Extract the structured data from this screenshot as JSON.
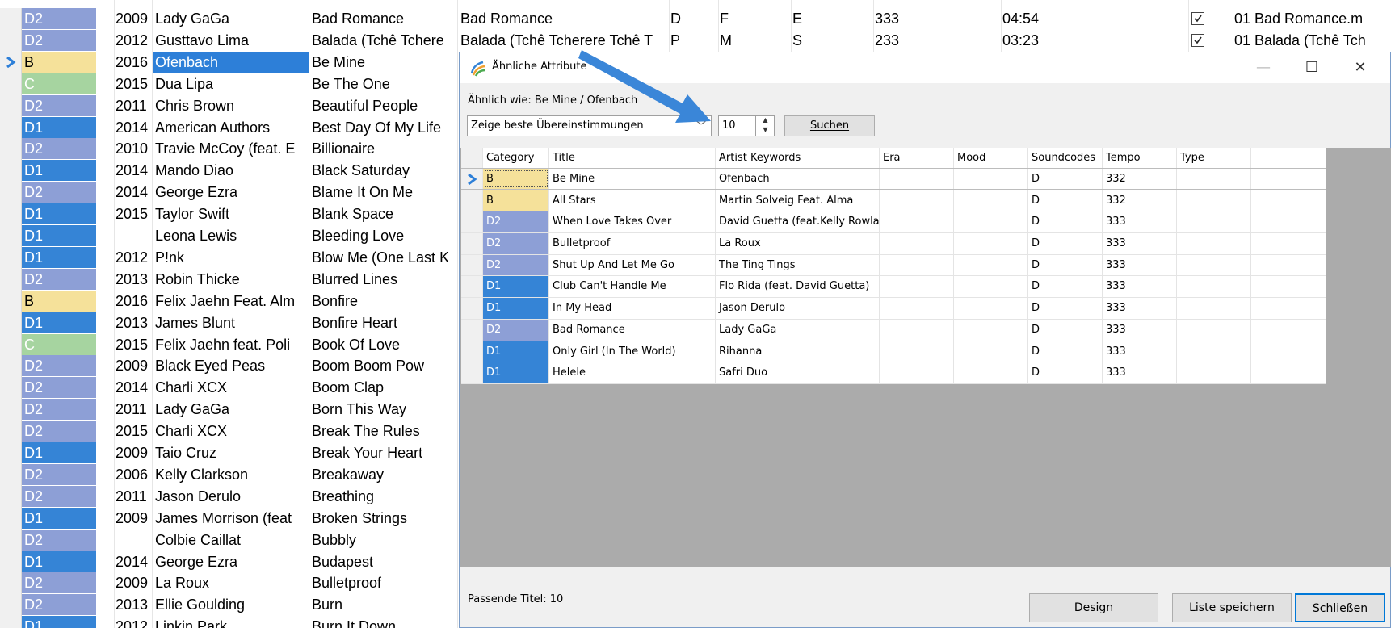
{
  "background_rows": [
    {
      "cat": "D2",
      "catColor": "#8d9fd6",
      "year": "2009",
      "artist": "Lady GaGa",
      "title": "Bad Romance",
      "title2": "Bad Romance",
      "d": "D",
      "f": "F",
      "e": "E",
      "num": "333",
      "time": "04:54",
      "checked": true,
      "file": "01 Bad Romance.m"
    },
    {
      "cat": "D2",
      "catColor": "#8d9fd6",
      "year": "2012",
      "artist": "Gusttavo Lima",
      "title": "Balada (Tchê Tchere",
      "title2": "Balada (Tchê Tcherere Tchê T",
      "d": "P",
      "f": "M",
      "e": "S",
      "num": "233",
      "time": "03:23",
      "checked": true,
      "file": "01 Balada (Tchê Tch"
    },
    {
      "cat": "B",
      "catColor": "#f5e19a",
      "year": "2016",
      "artist": "Ofenbach",
      "title": "Be Mine",
      "selected": true
    },
    {
      "cat": "C",
      "catColor": "#a6d4a0",
      "year": "2015",
      "artist": "Dua Lipa",
      "title": "Be The One"
    },
    {
      "cat": "D2",
      "catColor": "#8d9fd6",
      "year": "2011",
      "artist": "Chris Brown",
      "title": "Beautiful People"
    },
    {
      "cat": "D1",
      "catColor": "#3584d6",
      "year": "2014",
      "artist": "American Authors",
      "title": "Best Day Of My Life"
    },
    {
      "cat": "D2",
      "catColor": "#8d9fd6",
      "year": "2010",
      "artist": "Travie McCoy (feat. E",
      "title": "Billionaire"
    },
    {
      "cat": "D1",
      "catColor": "#3584d6",
      "year": "2014",
      "artist": "Mando Diao",
      "title": "Black Saturday"
    },
    {
      "cat": "D2",
      "catColor": "#8d9fd6",
      "year": "2014",
      "artist": "George Ezra",
      "title": "Blame It On Me"
    },
    {
      "cat": "D1",
      "catColor": "#3584d6",
      "year": "2015",
      "artist": "Taylor Swift",
      "title": "Blank Space"
    },
    {
      "cat": "D1",
      "catColor": "#3584d6",
      "year": "",
      "artist": "Leona Lewis",
      "title": "Bleeding Love"
    },
    {
      "cat": "D1",
      "catColor": "#3584d6",
      "year": "2012",
      "artist": "P!nk",
      "title": "Blow Me (One Last K"
    },
    {
      "cat": "D2",
      "catColor": "#8d9fd6",
      "year": "2013",
      "artist": "Robin Thicke",
      "title": "Blurred Lines"
    },
    {
      "cat": "B",
      "catColor": "#f5e19a",
      "year": "2016",
      "artist": "Felix Jaehn Feat. Alm",
      "title": "Bonfire"
    },
    {
      "cat": "D1",
      "catColor": "#3584d6",
      "year": "2013",
      "artist": "James Blunt",
      "title": "Bonfire Heart"
    },
    {
      "cat": "C",
      "catColor": "#a6d4a0",
      "year": "2015",
      "artist": "Felix Jaehn feat. Poli",
      "title": "Book Of Love"
    },
    {
      "cat": "D2",
      "catColor": "#8d9fd6",
      "year": "2009",
      "artist": "Black Eyed Peas",
      "title": "Boom Boom Pow"
    },
    {
      "cat": "D2",
      "catColor": "#8d9fd6",
      "year": "2014",
      "artist": "Charli XCX",
      "title": "Boom Clap"
    },
    {
      "cat": "D2",
      "catColor": "#8d9fd6",
      "year": "2011",
      "artist": "Lady GaGa",
      "title": "Born This Way"
    },
    {
      "cat": "D2",
      "catColor": "#8d9fd6",
      "year": "2015",
      "artist": "Charli XCX",
      "title": "Break The Rules"
    },
    {
      "cat": "D1",
      "catColor": "#3584d6",
      "year": "2009",
      "artist": "Taio Cruz",
      "title": "Break Your Heart"
    },
    {
      "cat": "D2",
      "catColor": "#8d9fd6",
      "year": "2006",
      "artist": "Kelly Clarkson",
      "title": "Breakaway"
    },
    {
      "cat": "D2",
      "catColor": "#8d9fd6",
      "year": "2011",
      "artist": "Jason Derulo",
      "title": "Breathing"
    },
    {
      "cat": "D1",
      "catColor": "#3584d6",
      "year": "2009",
      "artist": "James Morrison (feat",
      "title": "Broken Strings"
    },
    {
      "cat": "D2",
      "catColor": "#8d9fd6",
      "year": "",
      "artist": "Colbie Caillat",
      "title": "Bubbly"
    },
    {
      "cat": "D1",
      "catColor": "#3584d6",
      "year": "2014",
      "artist": "George Ezra",
      "title": "Budapest"
    },
    {
      "cat": "D2",
      "catColor": "#8d9fd6",
      "year": "2009",
      "artist": "La Roux",
      "title": "Bulletproof"
    },
    {
      "cat": "D2",
      "catColor": "#8d9fd6",
      "year": "2013",
      "artist": "Ellie Goulding",
      "title": "Burn"
    },
    {
      "cat": "D1",
      "catColor": "#3584d6",
      "year": "2012",
      "artist": "Linkin Park",
      "title": "Burn It Down"
    }
  ],
  "dialog": {
    "title": "Ähnliche Attribute",
    "similar_label": "Ähnlich wie: Be Mine / Ofenbach",
    "mode_value": "Zeige beste Übereinstimmungen",
    "count_value": "10",
    "search_label": "Suchen",
    "columns": [
      "Category",
      "Title",
      "Artist Keywords",
      "Era",
      "Mood",
      "Soundcodes",
      "Tempo",
      "Type"
    ],
    "rows": [
      {
        "cat": "B",
        "catColor": "#f5e19a",
        "title": "Be Mine",
        "artist": "Ofenbach",
        "era": "",
        "mood": "",
        "sound": "D",
        "tempo": "332",
        "type": ""
      },
      {
        "cat": "B",
        "catColor": "#f5e19a",
        "title": "All Stars",
        "artist": "Martin Solveig Feat. Alma",
        "era": "",
        "mood": "",
        "sound": "D",
        "tempo": "332",
        "type": ""
      },
      {
        "cat": "D2",
        "catColor": "#8d9fd6",
        "title": "When Love Takes Over",
        "artist": "David Guetta (feat.Kelly Rowlar",
        "era": "",
        "mood": "",
        "sound": "D",
        "tempo": "333",
        "type": ""
      },
      {
        "cat": "D2",
        "catColor": "#8d9fd6",
        "title": "Bulletproof",
        "artist": "La Roux",
        "era": "",
        "mood": "",
        "sound": "D",
        "tempo": "333",
        "type": ""
      },
      {
        "cat": "D2",
        "catColor": "#8d9fd6",
        "title": "Shut Up And Let Me Go",
        "artist": "The Ting Tings",
        "era": "",
        "mood": "",
        "sound": "D",
        "tempo": "333",
        "type": ""
      },
      {
        "cat": "D1",
        "catColor": "#3584d6",
        "title": "Club Can't Handle Me",
        "artist": "Flo Rida (feat. David Guetta)",
        "era": "",
        "mood": "",
        "sound": "D",
        "tempo": "333",
        "type": ""
      },
      {
        "cat": "D1",
        "catColor": "#3584d6",
        "title": "In My Head",
        "artist": "Jason Derulo",
        "era": "",
        "mood": "",
        "sound": "D",
        "tempo": "333",
        "type": ""
      },
      {
        "cat": "D2",
        "catColor": "#8d9fd6",
        "title": "Bad Romance",
        "artist": "Lady GaGa",
        "era": "",
        "mood": "",
        "sound": "D",
        "tempo": "333",
        "type": ""
      },
      {
        "cat": "D1",
        "catColor": "#3584d6",
        "title": "Only Girl (In The World)",
        "artist": "Rihanna",
        "era": "",
        "mood": "",
        "sound": "D",
        "tempo": "333",
        "type": ""
      },
      {
        "cat": "D1",
        "catColor": "#3584d6",
        "title": "Helele",
        "artist": "Safri Duo",
        "era": "",
        "mood": "",
        "sound": "D",
        "tempo": "333",
        "type": ""
      }
    ],
    "status": "Passende Titel: 10",
    "design_label": "Design",
    "save_label": "Liste speichern",
    "close_label": "Schließen"
  },
  "colors": {
    "accent": "#2d7fd8",
    "arrow": "#3a86d8"
  }
}
